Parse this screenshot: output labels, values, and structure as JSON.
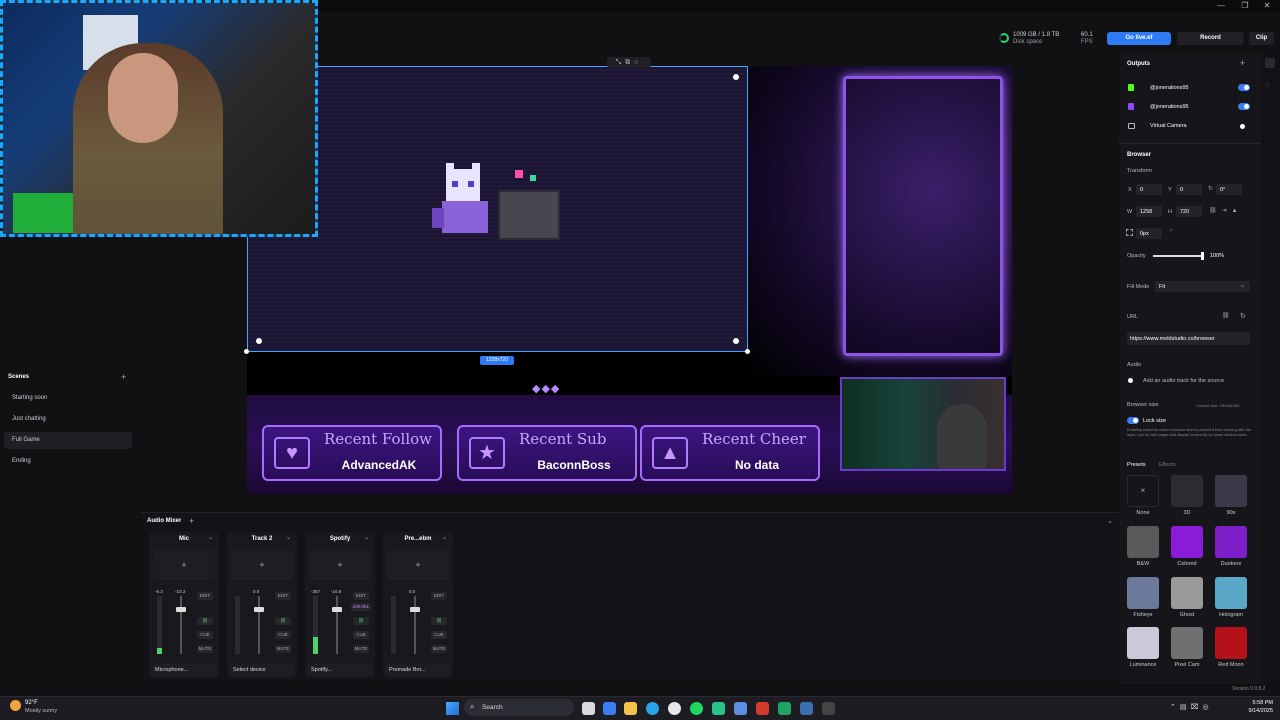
{
  "window": {
    "minimize": "—",
    "maximize": "❐",
    "close": "✕"
  },
  "stats": {
    "disk_value": "1009 GB / 1.8 TB",
    "disk_label": "Disk space",
    "fps_value": "60.1",
    "fps_label": "FPS"
  },
  "toolbar": {
    "go_live": "Go live.ef",
    "record": "Record",
    "clip": "Clip"
  },
  "canvas": {
    "size_badge": "1258x720",
    "alerts": [
      {
        "title": "Recent Follow",
        "name": "AdvancedAK",
        "icon": "♥"
      },
      {
        "title": "Recent Sub",
        "name": "BaconnBoss",
        "icon": "★"
      },
      {
        "title": "Recent Cheer",
        "name": "No data",
        "icon": "▲"
      }
    ],
    "diamonds": "◆◆◆"
  },
  "scenes": {
    "title": "Scenes",
    "add": "+",
    "items": [
      "Starting soon",
      "Just chatting",
      "Full Game",
      "Ending"
    ],
    "active": "Full Game"
  },
  "mixer": {
    "title": "Audio Mixer",
    "add": "+",
    "channels": [
      {
        "name": "Mic",
        "device": "Microphone...",
        "db_left": "-6.3",
        "db_right": "-10.3",
        "level": 0.1
      },
      {
        "name": "Track 2",
        "device": "Select device",
        "db_left": "",
        "db_right": "0.0",
        "level": 0.0
      },
      {
        "name": "Spotify",
        "device": "Spotify...",
        "db_left": "-367",
        "db_right": "-10.6",
        "level": 0.3,
        "badge": "100.0KL"
      },
      {
        "name": "Pre...ebm",
        "device": "Premade Bor...",
        "db_left": "",
        "db_right": "0.0",
        "level": 0.0
      }
    ],
    "buttons": {
      "edit": "EDIT",
      "cue": "CUE",
      "mute": "MUTE"
    }
  },
  "right_panel": {
    "outputs_title": "Outputs",
    "outputs": [
      {
        "name": "@jonerations95",
        "enabled": true
      },
      {
        "name": "@jonerations95",
        "enabled": true
      },
      {
        "name": "Virtual Camera",
        "enabled": false
      }
    ],
    "source_title": "Browser",
    "transform_label": "Transform",
    "x_label": "X",
    "x_value": "0",
    "y_label": "Y",
    "y_value": "0",
    "rotation_value": "0°",
    "w_label": "W",
    "w_value": "1258",
    "h_label": "H",
    "h_value": "720",
    "radius_value": "0px",
    "opacity_label": "Opacity",
    "opacity_value": "100%",
    "opacity_fraction": 1.0,
    "fill_mode_label": "Fill Mode",
    "fill_mode_value": "Fit",
    "url_label": "URL",
    "url_value": "https://www.meldstudio.co/browser",
    "audio_label": "Audio",
    "audio_option": "Add an audio track for the source",
    "browser_size_label": "Browser size",
    "current_size": "Current size: 1920x1080",
    "lock_size_label": "Lock size",
    "lock_size_desc": "Enabling locks the current browser size to prevent it from resizing with the layer. Use for web pages that display incorrectly for some window sizes.",
    "presets_tab": "Presets",
    "effects_tab": "Effects",
    "presets": [
      "None",
      "3D",
      "90s",
      "B&W",
      "Colored",
      "Duotone",
      "Fisheye",
      "Ghost",
      "Hologram",
      "Luminance",
      "Pixel Cam",
      "Red Moon"
    ],
    "version": "Version 0.9.8.2"
  },
  "taskbar": {
    "weather_temp": "92°F",
    "weather_desc": "Mostly sunny",
    "search": "Search",
    "time": "5:58 PM",
    "date": "9/14/2025"
  }
}
